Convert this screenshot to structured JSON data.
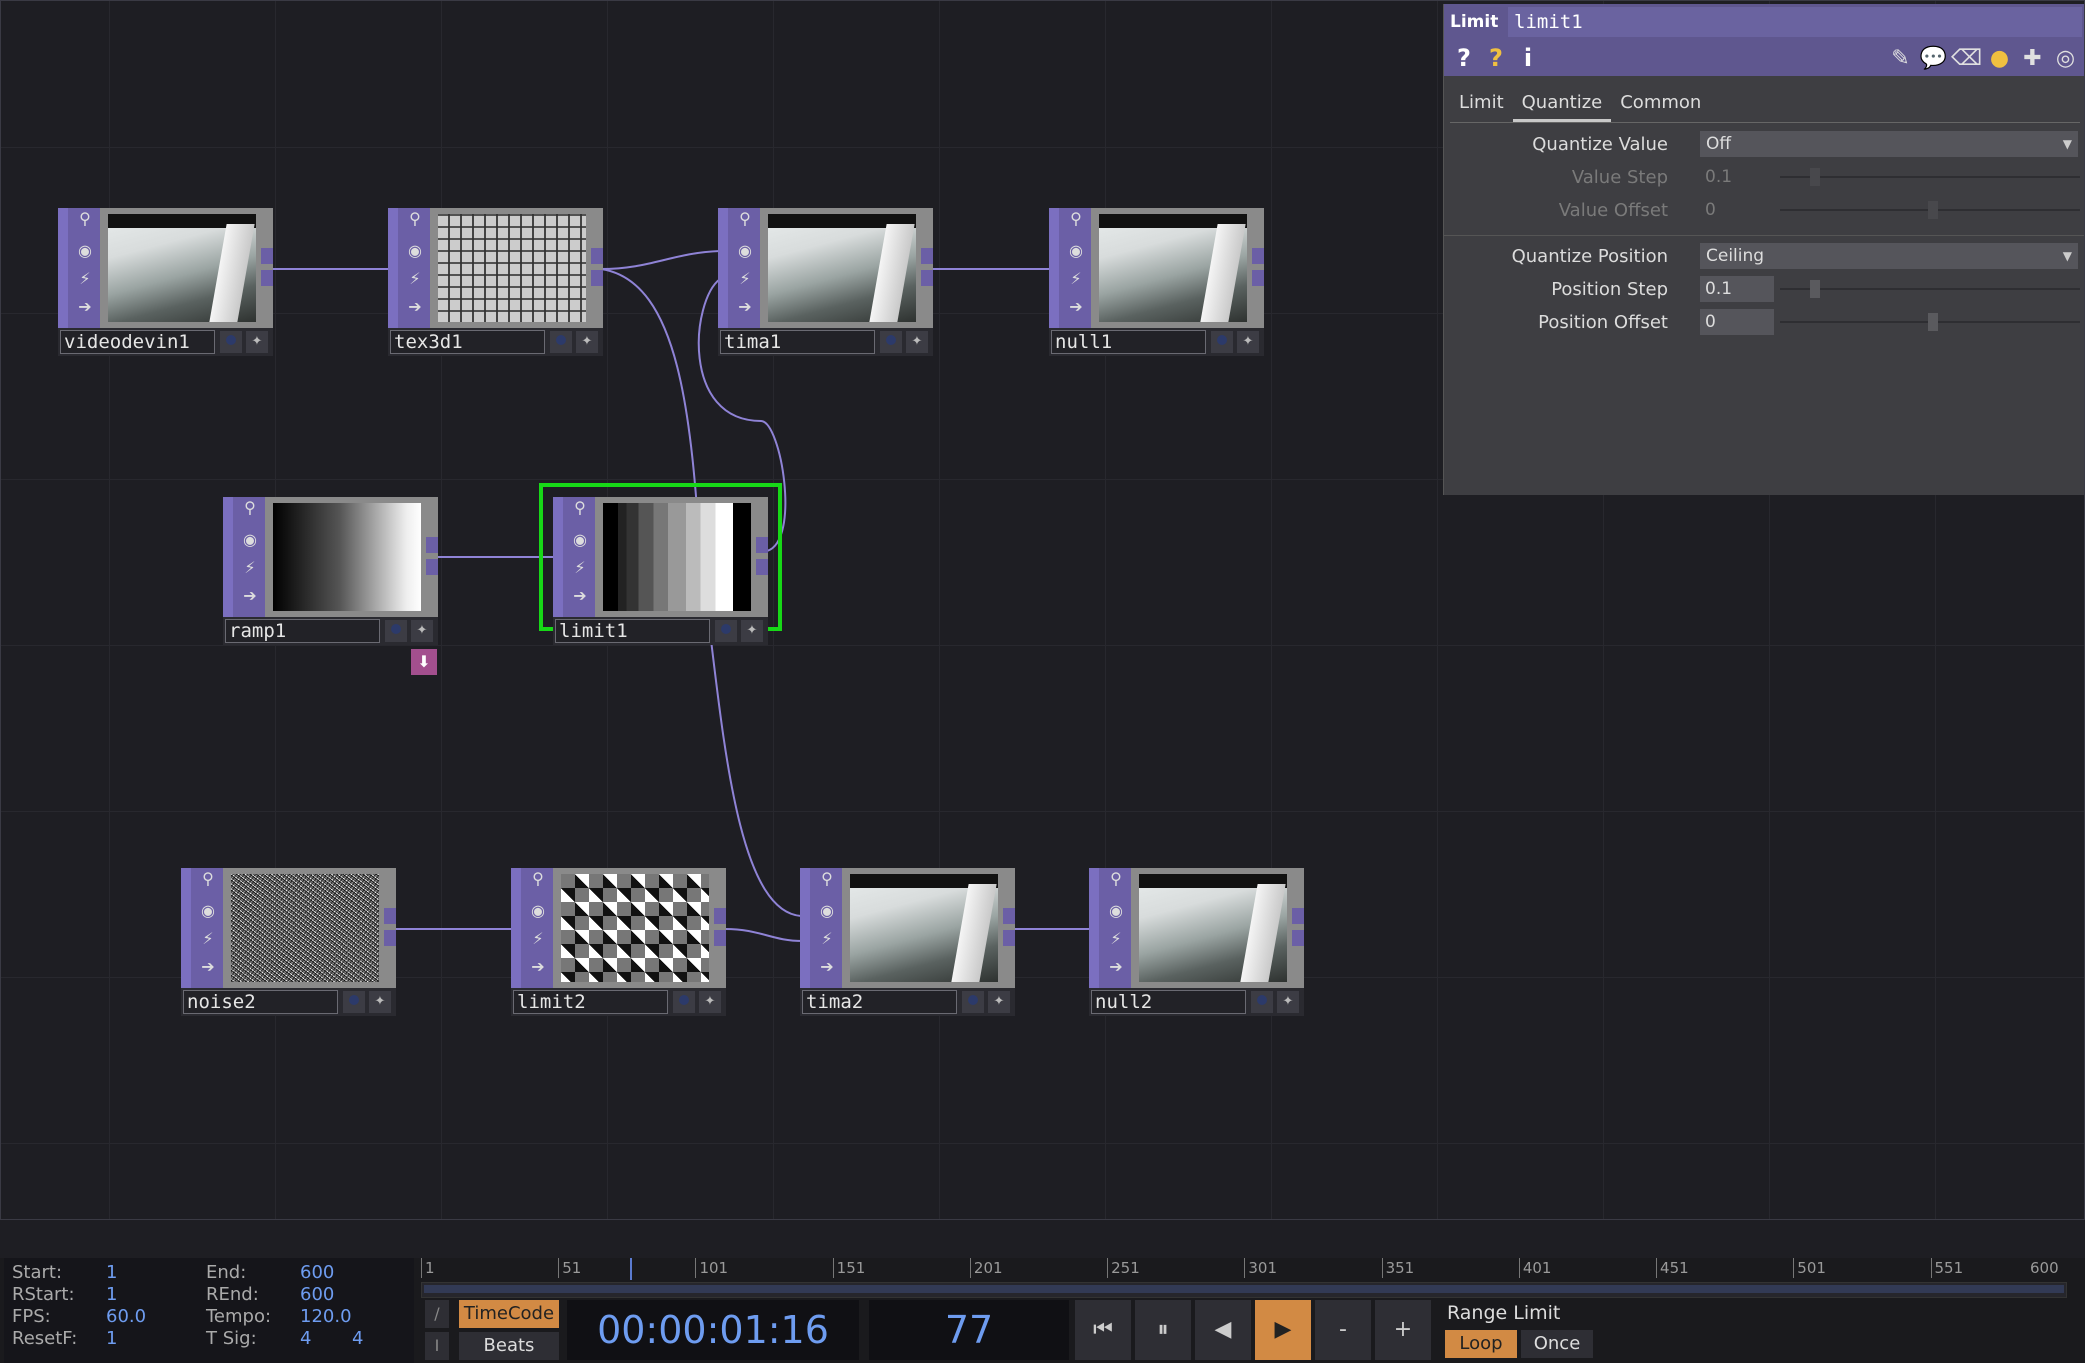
{
  "network": {
    "nodes": [
      {
        "name": "videodevin1",
        "thumb": "video"
      },
      {
        "name": "tex3d1",
        "thumb": "tex3d"
      },
      {
        "name": "tima1",
        "thumb": "video"
      },
      {
        "name": "null1",
        "thumb": "video"
      },
      {
        "name": "ramp1",
        "thumb": "ramp"
      },
      {
        "name": "limit1",
        "thumb": "limit",
        "selected": true
      },
      {
        "name": "noise2",
        "thumb": "noise"
      },
      {
        "name": "limit2",
        "thumb": "pixel"
      },
      {
        "name": "tima2",
        "thumb": "video"
      },
      {
        "name": "null2",
        "thumb": "video"
      }
    ],
    "wire_color": "#8f83d6",
    "selected_color": "#17d817"
  },
  "params": {
    "type": "Limit",
    "name": "limit1",
    "toolbar_left": [
      "?",
      "?",
      "i"
    ],
    "tabs": [
      "Limit",
      "Quantize",
      "Common"
    ],
    "active_tab": "Quantize",
    "rows": {
      "quantize_value": {
        "label": "Quantize Value",
        "value": "Off"
      },
      "value_step": {
        "label": "Value Step",
        "value": "0.1"
      },
      "value_offset": {
        "label": "Value Offset",
        "value": "0"
      },
      "quantize_position": {
        "label": "Quantize Position",
        "value": "Ceiling"
      },
      "position_step": {
        "label": "Position Step",
        "value": "0.1"
      },
      "position_offset": {
        "label": "Position Offset",
        "value": "0"
      }
    },
    "header_color": "#5f578f"
  },
  "timeline": {
    "start_label": "Start:",
    "start": "1",
    "end_label": "End:",
    "end": "600",
    "rstart_label": "RStart:",
    "rstart": "1",
    "rend_label": "REnd:",
    "rend": "600",
    "fps_label": "FPS:",
    "fps": "60.0",
    "tempo_label": "Tempo:",
    "tempo": "120.0",
    "resetf_label": "ResetF:",
    "resetf": "1",
    "tsig_label": "T Sig:",
    "tsig_a": "4",
    "tsig_b": "4",
    "ticks": [
      "1",
      "51",
      "101",
      "151",
      "201",
      "251",
      "301",
      "351",
      "401",
      "451",
      "501",
      "551",
      "600"
    ],
    "current_frame": 77,
    "timecode_button": "TimeCode",
    "beats_button": "Beats",
    "timecode": "00:00:01:16",
    "frame": "77",
    "minus": "-",
    "plus": "+",
    "range_limit_label": "Range Limit",
    "loop_button": "Loop",
    "once_button": "Once",
    "accent": "#d28a44",
    "value_color": "#6e9cf0"
  }
}
